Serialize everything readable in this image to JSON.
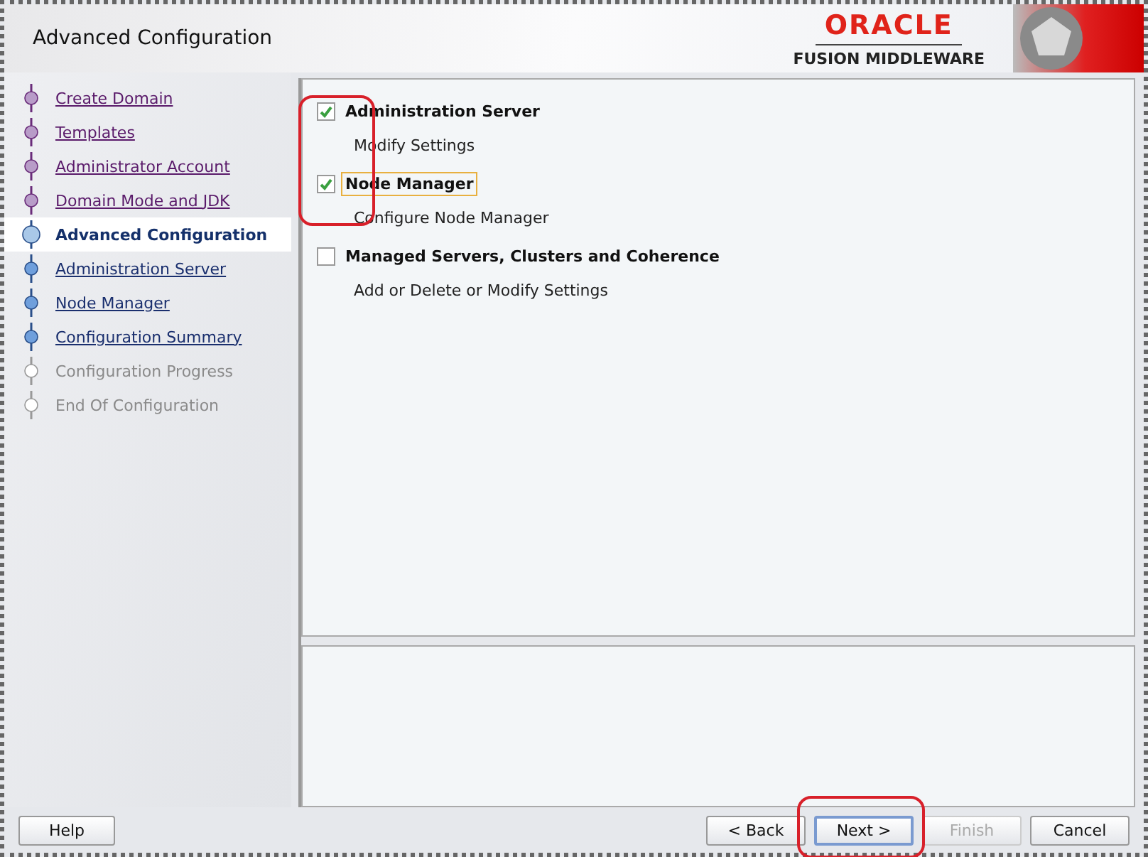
{
  "header": {
    "title": "Advanced Configuration",
    "brand": "ORACLE",
    "product": "FUSION MIDDLEWARE"
  },
  "steps": [
    {
      "label": "Create Domain",
      "kind": "done",
      "selected": false
    },
    {
      "label": "Templates",
      "kind": "done",
      "selected": false
    },
    {
      "label": "Administrator Account",
      "kind": "done",
      "selected": false
    },
    {
      "label": "Domain Mode and JDK",
      "kind": "done",
      "selected": false
    },
    {
      "label": "Advanced Configuration",
      "kind": "current",
      "selected": true
    },
    {
      "label": "Administration Server",
      "kind": "todo",
      "selected": false
    },
    {
      "label": "Node Manager",
      "kind": "todo",
      "selected": false
    },
    {
      "label": "Configuration Summary",
      "kind": "todo",
      "selected": false
    },
    {
      "label": "Configuration Progress",
      "kind": "disabled",
      "selected": false
    },
    {
      "label": "End Of Configuration",
      "kind": "disabled",
      "selected": false
    }
  ],
  "options": [
    {
      "label": "Administration Server",
      "description": "Modify Settings",
      "checked": true,
      "focused": false
    },
    {
      "label": "Node Manager",
      "description": "Configure Node Manager",
      "checked": true,
      "focused": true
    },
    {
      "label": "Managed Servers, Clusters and Coherence",
      "description": "Add or Delete or Modify Settings",
      "checked": false,
      "focused": false
    }
  ],
  "buttons": [
    {
      "label": "Help",
      "kind": "help",
      "disabled": false,
      "default": false
    },
    {
      "label": "< Back",
      "kind": "nav",
      "disabled": false,
      "default": false
    },
    {
      "label": "Next >",
      "kind": "nav",
      "disabled": false,
      "default": true
    },
    {
      "label": "Finish",
      "kind": "nav",
      "disabled": true,
      "default": false
    },
    {
      "label": "Cancel",
      "kind": "nav",
      "disabled": false,
      "default": false
    }
  ]
}
